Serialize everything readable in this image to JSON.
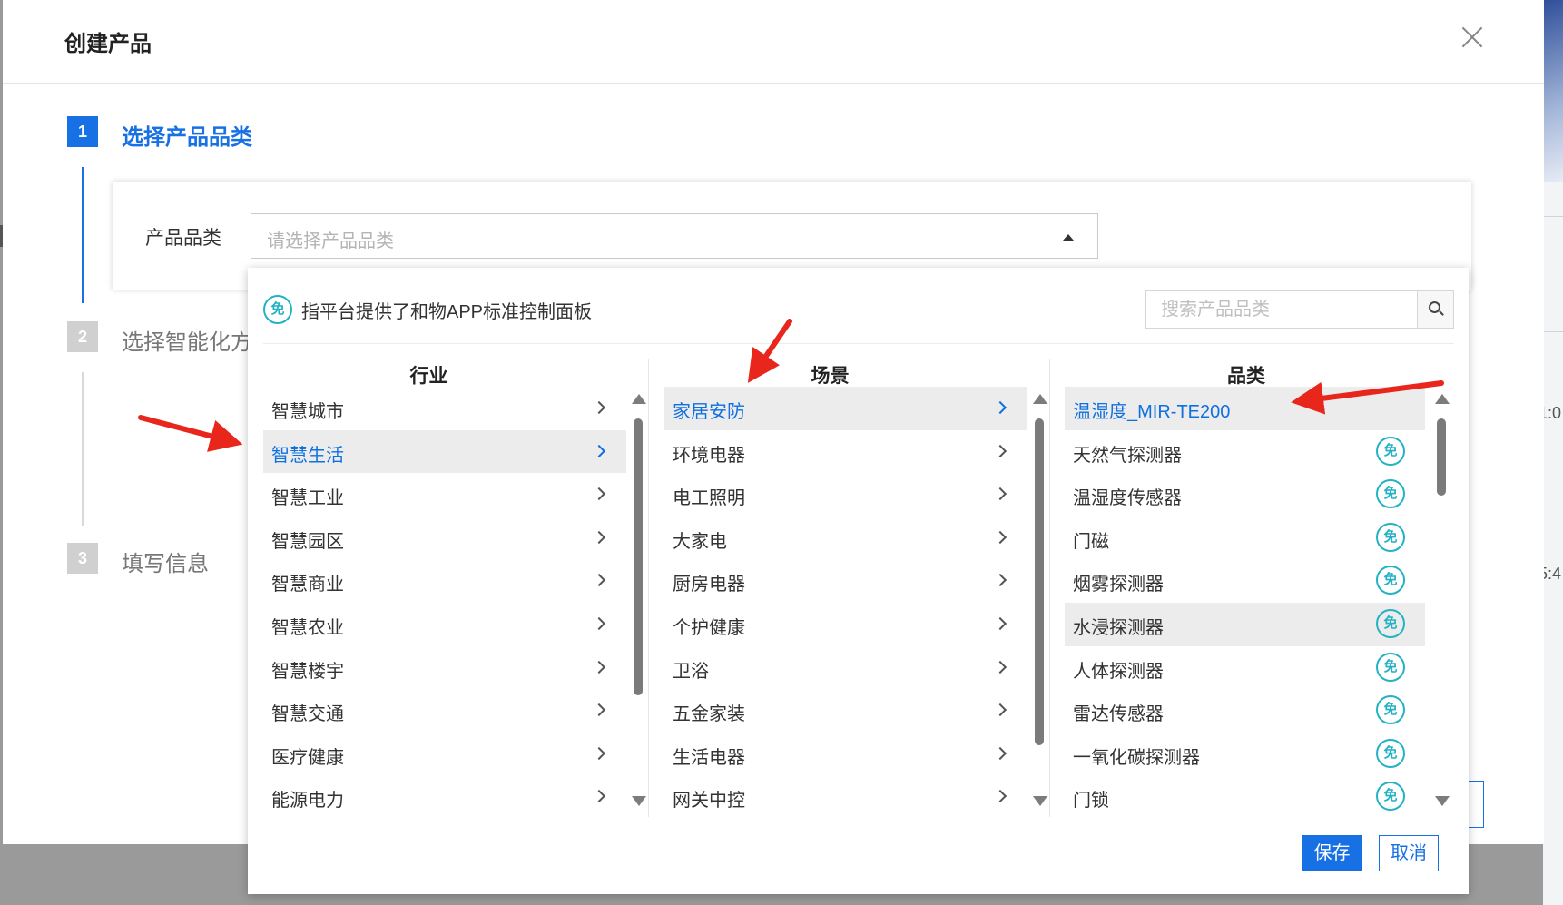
{
  "modal": {
    "title": "创建产品"
  },
  "steps": [
    {
      "number": "1",
      "label": "选择产品品类",
      "active": true
    },
    {
      "number": "2",
      "label": "选择智能化方",
      "active": false
    },
    {
      "number": "3",
      "label": "填写信息",
      "active": false
    }
  ],
  "category_field": {
    "label": "产品品类",
    "placeholder": "请选择产品品类"
  },
  "dropdown": {
    "free_badge": "免",
    "legend_text": "指平台提供了和物APP标准控制面板",
    "search_placeholder": "搜索产品品类",
    "columns": {
      "industry": {
        "header": "行业",
        "items": [
          "智慧城市",
          "智慧生活",
          "智慧工业",
          "智慧园区",
          "智慧商业",
          "智慧农业",
          "智慧楼宇",
          "智慧交通",
          "医疗健康",
          "能源电力"
        ],
        "selected": "智慧生活"
      },
      "scene": {
        "header": "场景",
        "items": [
          "家居安防",
          "环境电器",
          "电工照明",
          "大家电",
          "厨房电器",
          "个护健康",
          "卫浴",
          "五金家装",
          "生活电器",
          "网关中控"
        ],
        "selected": "家居安防"
      },
      "category": {
        "header": "品类",
        "items": [
          "温湿度_MIR-TE200",
          "天然气探测器",
          "温湿度传感器",
          "门磁",
          "烟雾探测器",
          "水浸探测器",
          "人体探测器",
          "雷达传感器",
          "一氧化碳探测器",
          "门锁"
        ],
        "selected": "温湿度_MIR-TE200",
        "hovered": "水浸探测器"
      }
    },
    "save_label": "保存",
    "cancel_label": "取消"
  },
  "background_fragments": [
    "1:0",
    "5:4"
  ],
  "colors": {
    "primary": "#1770e4",
    "free_badge": "#22b2c4",
    "annotation_arrow": "#e8261c",
    "inactive_step": "#d0d0d0"
  }
}
